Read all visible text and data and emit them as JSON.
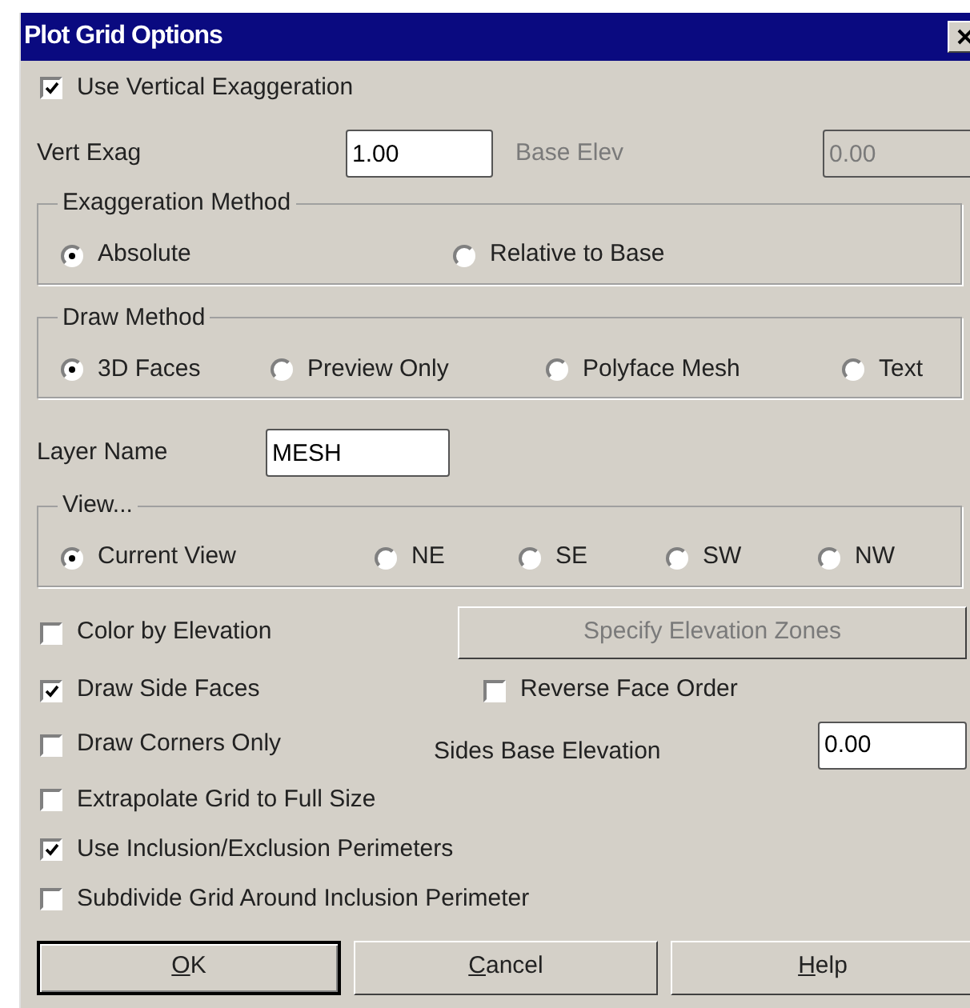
{
  "window": {
    "title": "Plot Grid Options"
  },
  "use_vertical_exaggeration": {
    "label": "Use Vertical Exaggeration",
    "checked": true
  },
  "vert_exag": {
    "label": "Vert Exag",
    "value": "1.00"
  },
  "base_elev": {
    "label": "Base Elev",
    "value": "0.00",
    "disabled": true
  },
  "groups": [
    {
      "title": "Exaggeration Method",
      "options": [
        {
          "label": "Absolute",
          "selected": true
        },
        {
          "label": "Relative to Base",
          "selected": false
        }
      ]
    },
    {
      "title": "Draw Method",
      "options": [
        {
          "label": "3D Faces",
          "selected": true
        },
        {
          "label": "Preview Only",
          "selected": false
        },
        {
          "label": "Polyface Mesh",
          "selected": false
        },
        {
          "label": "Text",
          "selected": false
        }
      ]
    }
  ],
  "layer_name": {
    "label": "Layer Name",
    "value": "MESH"
  },
  "view": {
    "title": "View...",
    "options": [
      {
        "label": "Current View",
        "selected": true
      },
      {
        "label": "NE",
        "selected": false
      },
      {
        "label": "SE",
        "selected": false
      },
      {
        "label": "SW",
        "selected": false
      },
      {
        "label": "NW",
        "selected": false
      }
    ]
  },
  "color_by_elevation": {
    "label": "Color by Elevation",
    "checked": false
  },
  "specify_elevation_zones": {
    "label": "Specify Elevation Zones",
    "disabled": true
  },
  "draw_side_faces": {
    "label": "Draw Side Faces",
    "checked": true
  },
  "reverse_face_order": {
    "label": "Reverse Face Order",
    "checked": false
  },
  "draw_corners_only": {
    "label": "Draw Corners Only",
    "checked": false
  },
  "sides_base_elevation": {
    "label": "Sides Base Elevation",
    "value": "0.00"
  },
  "checkboxes": [
    {
      "label": "Extrapolate Grid to Full Size",
      "checked": false
    },
    {
      "label": "Use Inclusion/Exclusion Perimeters",
      "checked": true
    },
    {
      "label": "Subdivide Grid Around Inclusion Perimeter",
      "checked": false
    }
  ],
  "buttons": [
    {
      "label": "OK",
      "default": true
    },
    {
      "label": "Cancel",
      "default": false
    },
    {
      "label": "Help",
      "default": false
    }
  ]
}
